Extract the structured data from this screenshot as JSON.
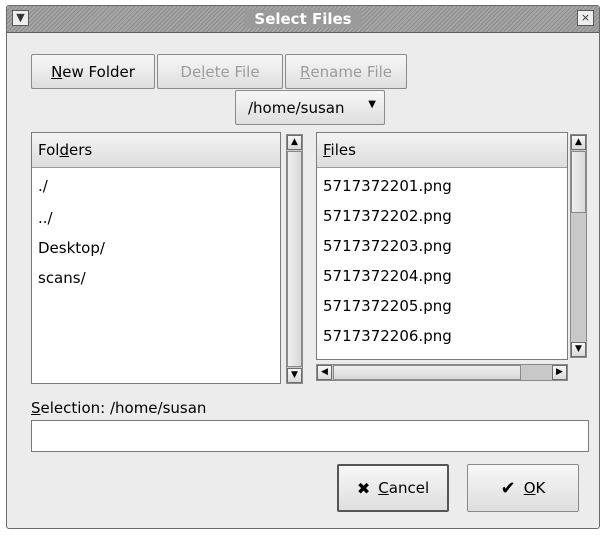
{
  "window": {
    "title": "Select Files"
  },
  "toolbar": {
    "new_folder": {
      "pre": "",
      "u": "N",
      "post": "ew Folder"
    },
    "delete_file": {
      "pre": "De",
      "u": "l",
      "post": "ete File"
    },
    "rename_file": {
      "pre": "",
      "u": "R",
      "post": "ename File"
    }
  },
  "path_dropdown": {
    "value": "/home/susan"
  },
  "folders": {
    "header": {
      "pre": "Fol",
      "u": "d",
      "post": "ers"
    },
    "items": [
      "./",
      "../",
      "Desktop/",
      "scans/"
    ]
  },
  "files": {
    "header": {
      "pre": "",
      "u": "F",
      "post": "iles"
    },
    "items": [
      "5717372201.png",
      "5717372202.png",
      "5717372203.png",
      "5717372204.png",
      "5717372205.png",
      "5717372206.png"
    ]
  },
  "selection": {
    "label_pre": "",
    "label_u": "S",
    "label_post": "election: /home/susan",
    "value": ""
  },
  "buttons": {
    "cancel": {
      "u": "C",
      "post": "ancel"
    },
    "ok": {
      "u": "O",
      "post": "K"
    }
  }
}
